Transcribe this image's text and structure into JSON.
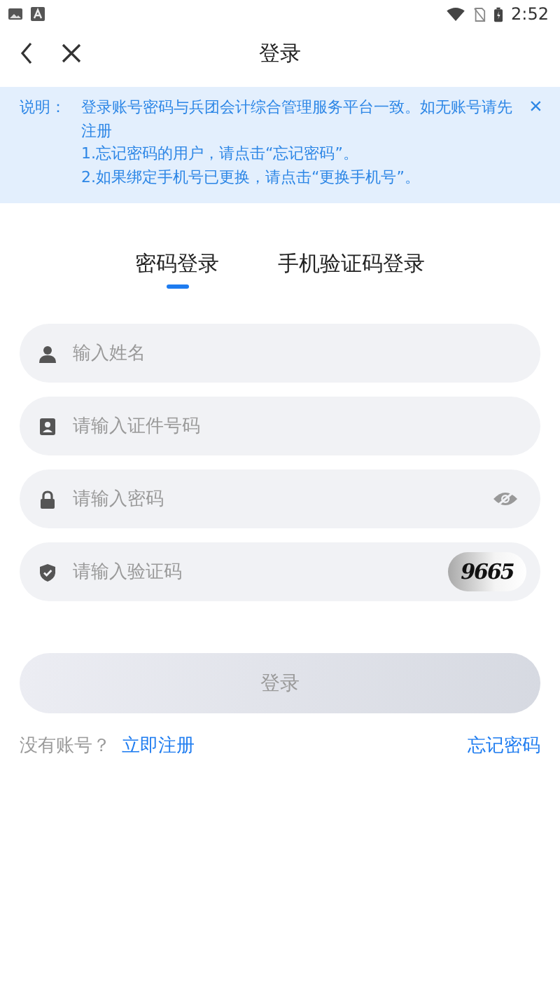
{
  "status_bar": {
    "time": "2:52"
  },
  "header": {
    "title": "登录"
  },
  "notice": {
    "label": "说明：",
    "lines": [
      "登录账号密码与兵团会计综合管理服务平台一致。如无账号请先注册",
      "1.忘记密码的用户，请点击“忘记密码”。",
      "2.如果绑定手机号已更换，请点击“更换手机号”。"
    ],
    "close": "×"
  },
  "tabs": [
    {
      "label": "密码登录",
      "selected": true
    },
    {
      "label": "手机验证码登录",
      "selected": false
    }
  ],
  "fields": [
    {
      "kind": "name",
      "placeholder": "输入姓名"
    },
    {
      "kind": "id",
      "placeholder": "请输入证件号码"
    },
    {
      "kind": "password",
      "placeholder": "请输入密码"
    },
    {
      "kind": "captcha",
      "placeholder": "请输入验证码",
      "captcha": "9665"
    }
  ],
  "login_button": {
    "label": "登录",
    "disabled": true
  },
  "footer": {
    "prompt": "没有账号？",
    "register": "立即注册",
    "forgot": "忘记密码"
  }
}
